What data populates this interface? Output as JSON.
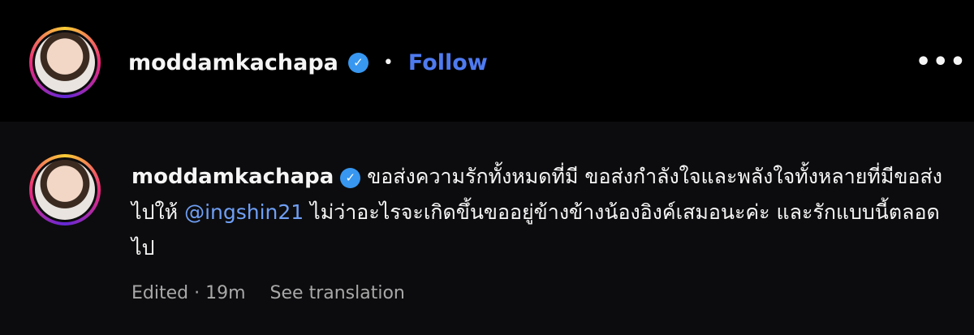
{
  "post_header": {
    "username": "moddamkachapa",
    "separator": "•",
    "follow_label": "Follow",
    "more_label": "•••"
  },
  "comment": {
    "username": "moddamkachapa",
    "text_part1": "ขอส่งความรักทั้งหมดที่มี ขอส่งกำลังใจและพลังใจทั้งหลายที่มีขอส่งไปให้ ",
    "mention": "@ingshin21",
    "text_part2": " ไม่ว่าอะไรจะเกิดขึ้นขออยู่ข้างข้างน้องอิงค์เสมอนะค่ะ และรักแบบนี้ตลอดไป",
    "edited_label": "Edited",
    "time_separator": "·",
    "time_ago": "19m",
    "see_translation_label": "See translation"
  },
  "icons": {
    "verified": "verified-badge-icon",
    "more": "more-options-icon"
  },
  "colors": {
    "background": "#0c0c0e",
    "link_blue": "#4f7bf0",
    "mention_blue": "#6f9ff5",
    "verified_blue": "#3897f0",
    "muted_text": "#a8a8a8"
  }
}
